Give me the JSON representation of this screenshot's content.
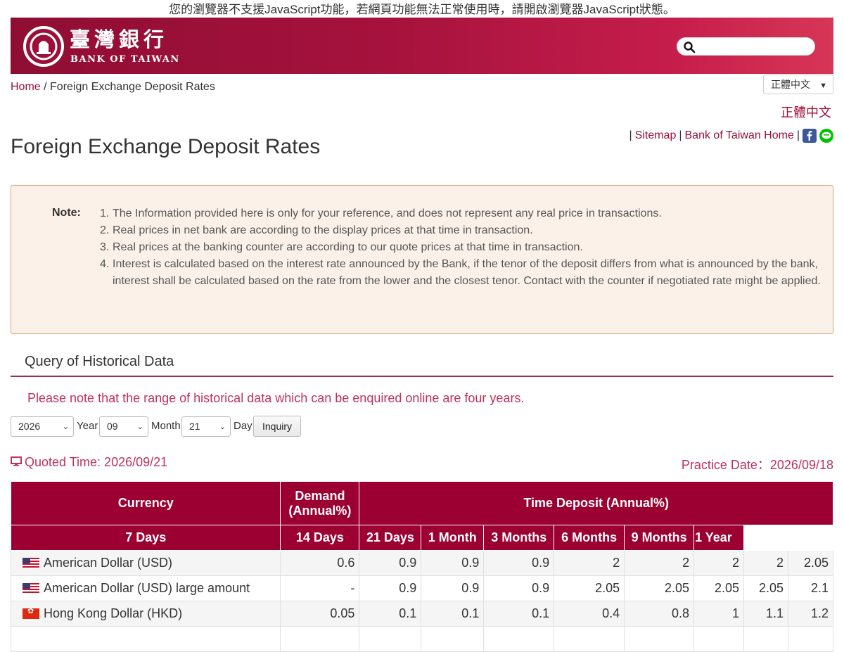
{
  "noscript_message": "您的瀏覽器不支援JavaScript功能，若網頁功能無法正常使用時，請開啟瀏覽器JavaScript狀態。",
  "header": {
    "logo_cn": "臺灣銀行",
    "logo_en": "BANK OF TAIWAN",
    "search_placeholder": ""
  },
  "breadcrumb": {
    "home": "Home",
    "separator": " / ",
    "current": "Foreign Exchange Deposit Rates"
  },
  "language_select": {
    "selected": "正體中文"
  },
  "language_link": "正體中文",
  "top_links": {
    "sep": "|",
    "sitemap": "Sitemap",
    "home": "Bank of Taiwan Home"
  },
  "page_title": "Foreign Exchange Deposit Rates",
  "note": {
    "label": "Note:",
    "items": [
      "The Information provided here is only for your reference, and does not represent any real price in transactions.",
      "Real prices in net bank are according to the display prices at that time in transaction.",
      "Real prices at the banking counter are according to our quote prices at that time in transaction.",
      "Interest is calculated based on the interest rate announced by the Bank, if the tenor of the deposit differs from what is announced by the bank, interest shall be calculated based on the rate from the lower and the closest tenor. Contact with the counter if negotiated rate might be applied."
    ]
  },
  "history": {
    "heading": "Query of Historical Data",
    "note": "Please note that the range of historical data which can be enquired online are four years.",
    "year_value": "2026",
    "year_label": "Year",
    "month_value": "09",
    "month_label": "Month",
    "day_value": "21",
    "day_label": "Day",
    "inquiry_button": "Inquiry"
  },
  "quoted_time": "Quoted Time: 2026/09/21",
  "practice_date": "Practice Date：2026/09/18",
  "table": {
    "header_currency": "Currency",
    "header_demand": "Demand (Annual%)",
    "header_time_deposit": "Time Deposit (Annual%)",
    "subheaders": [
      "7 Days",
      "14 Days",
      "21 Days",
      "1 Month",
      "3 Months",
      "6 Months",
      "9 Months",
      "1 Year"
    ],
    "rows": [
      {
        "currency": "American Dollar (USD)",
        "flag": "us",
        "values": [
          "0.6",
          "0.9",
          "0.9",
          "0.9",
          "2",
          "2",
          "2",
          "2",
          "2.05"
        ]
      },
      {
        "currency": "American Dollar (USD) large amount",
        "flag": "us",
        "values": [
          "-",
          "0.9",
          "0.9",
          "0.9",
          "2.05",
          "2.05",
          "2.05",
          "2.05",
          "2.1"
        ]
      },
      {
        "currency": "Hong Kong Dollar (HKD)",
        "flag": "hk",
        "values": [
          "0.05",
          "0.1",
          "0.1",
          "0.1",
          "0.4",
          "0.8",
          "1",
          "1.1",
          "1.2"
        ]
      }
    ]
  },
  "colors": {
    "brand": "#9c0033",
    "accent_text": "#c0315a",
    "note_bg": "#fbf1e8"
  }
}
